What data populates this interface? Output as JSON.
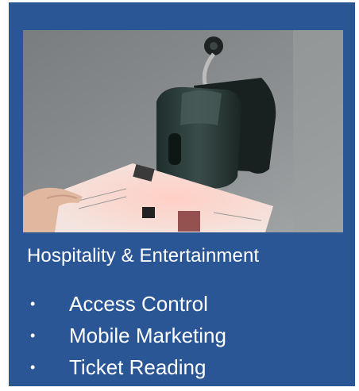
{
  "card": {
    "background": "#2a5696",
    "image_description": "barcode-scanner-photo",
    "title": "Hospitality & Entertainment",
    "bullets": [
      {
        "label": "Access Control"
      },
      {
        "label": "Mobile Marketing"
      },
      {
        "label": "Ticket Reading"
      }
    ],
    "bullet_glyph": "•"
  }
}
